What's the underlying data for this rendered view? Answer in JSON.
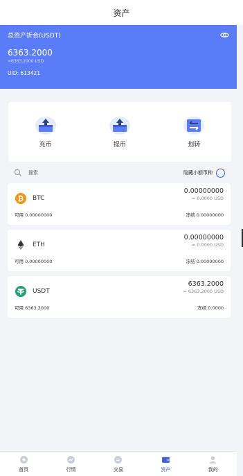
{
  "header": {
    "title": "资产"
  },
  "balance": {
    "title": "总资产折合(USDT)",
    "amount": "6363.2000",
    "usd": "≈6363.2000 USD",
    "uid": "UID: 613421"
  },
  "actions": [
    {
      "label": "充币",
      "icon": "deposit-icon"
    },
    {
      "label": "提币",
      "icon": "withdraw-icon"
    },
    {
      "label": "划转",
      "icon": "transfer-icon"
    }
  ],
  "search": {
    "placeholder": "搜索",
    "hide_small_label": "隐藏小额币种"
  },
  "coins": [
    {
      "symbol": "BTC",
      "amount": "0.00000000",
      "usd": "≈ 0.0000 USD",
      "available_label": "可用",
      "available": "0.00000000",
      "frozen_label": "冻结",
      "frozen": "0.00000000",
      "color": "#f7931a"
    },
    {
      "symbol": "ETH",
      "amount": "0.00000000",
      "usd": "≈ 0.0000 USD",
      "available_label": "可用",
      "available": "0.00000000",
      "frozen_label": "冻结",
      "frozen": "0.00000000",
      "color": "#343434"
    },
    {
      "symbol": "USDT",
      "amount": "6363.2000",
      "usd": "≈ 6363.2000 USD",
      "available_label": "可用",
      "available": "6363.2000",
      "frozen_label": "冻结",
      "frozen": "0.0000",
      "color": "#26a17b"
    }
  ],
  "tabbar": [
    {
      "label": "首页",
      "icon": "home-icon"
    },
    {
      "label": "行情",
      "icon": "market-icon"
    },
    {
      "label": "交易",
      "icon": "trade-icon"
    },
    {
      "label": "资产",
      "icon": "wallet-icon",
      "active": true
    },
    {
      "label": "我的",
      "icon": "profile-icon"
    }
  ],
  "colors": {
    "brand": "#5b7cf7",
    "accent": "#3e5fd0"
  }
}
